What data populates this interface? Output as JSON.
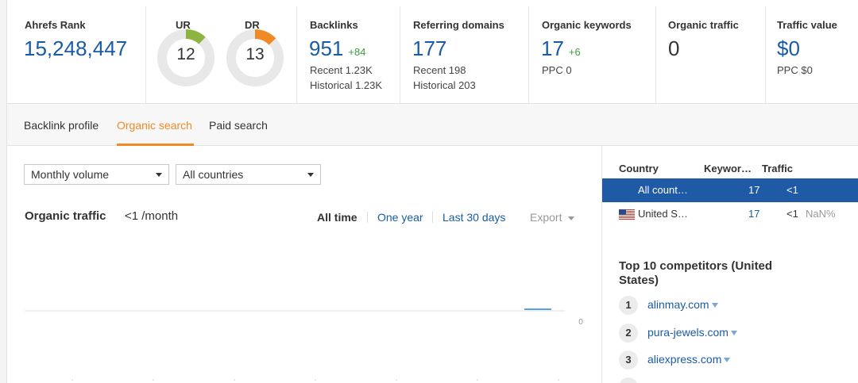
{
  "metrics": {
    "ahrefs_rank": {
      "label": "Ahrefs Rank",
      "value": "15,248,447"
    },
    "ur": {
      "label": "UR",
      "value": "12"
    },
    "dr": {
      "label": "DR",
      "value": "13"
    },
    "backlinks": {
      "label": "Backlinks",
      "value": "951",
      "delta": "+84",
      "recent": "Recent 1.23K",
      "historical": "Historical 1.23K"
    },
    "referring_domains": {
      "label": "Referring domains",
      "value": "177",
      "recent": "Recent 198",
      "historical": "Historical 203"
    },
    "organic_keywords": {
      "label": "Organic keywords",
      "value": "17",
      "delta": "+6",
      "ppc": "PPC 0"
    },
    "organic_traffic": {
      "label": "Organic traffic",
      "value": "0"
    },
    "traffic_value": {
      "label": "Traffic value",
      "value": "$0",
      "ppc": "PPC $0"
    }
  },
  "colors": {
    "accent": "#f08a24",
    "link": "#1a5ba6",
    "selected_row": "#1f5aa6",
    "ur_gauge": "#8db43e",
    "dr_gauge": "#f08a24"
  },
  "tabs": [
    {
      "label": "Backlink profile",
      "active": false
    },
    {
      "label": "Organic search",
      "active": true
    },
    {
      "label": "Paid search",
      "active": false
    }
  ],
  "filters": {
    "volume": "Monthly volume",
    "country": "All countries"
  },
  "chart": {
    "title": "Organic traffic",
    "subtitle": "<1 /month",
    "ranges": [
      "All time",
      "One year",
      "Last 30 days"
    ],
    "selected_range": "All time",
    "export_label": "Export"
  },
  "chart_data": {
    "type": "line",
    "title": "Organic traffic",
    "xlabel": "",
    "ylabel": "",
    "y_tick_labels": [
      "0"
    ],
    "series": [
      {
        "values": [
          0,
          0,
          0,
          0,
          0,
          0,
          0,
          0,
          0,
          0,
          0,
          0,
          0,
          0,
          0,
          0,
          0,
          0,
          0,
          1,
          0
        ]
      }
    ],
    "grid": true
  },
  "country_table": {
    "headers": [
      "Country",
      "Keywor…",
      "Traffic"
    ],
    "rows": [
      {
        "country": "All count…",
        "keywords": "17",
        "traffic": "<1",
        "share": "",
        "selected": true
      },
      {
        "country": "United S…",
        "keywords": "17",
        "traffic": "<1",
        "share": "NaN%",
        "selected": false,
        "flag": "us-flag-icon"
      }
    ]
  },
  "competitors": {
    "title": "Top 10 competitors (United States)",
    "items": [
      {
        "rank": "1",
        "domain": "alinmay.com"
      },
      {
        "rank": "2",
        "domain": "pura-jewels.com"
      },
      {
        "rank": "3",
        "domain": "aliexpress.com"
      }
    ]
  }
}
